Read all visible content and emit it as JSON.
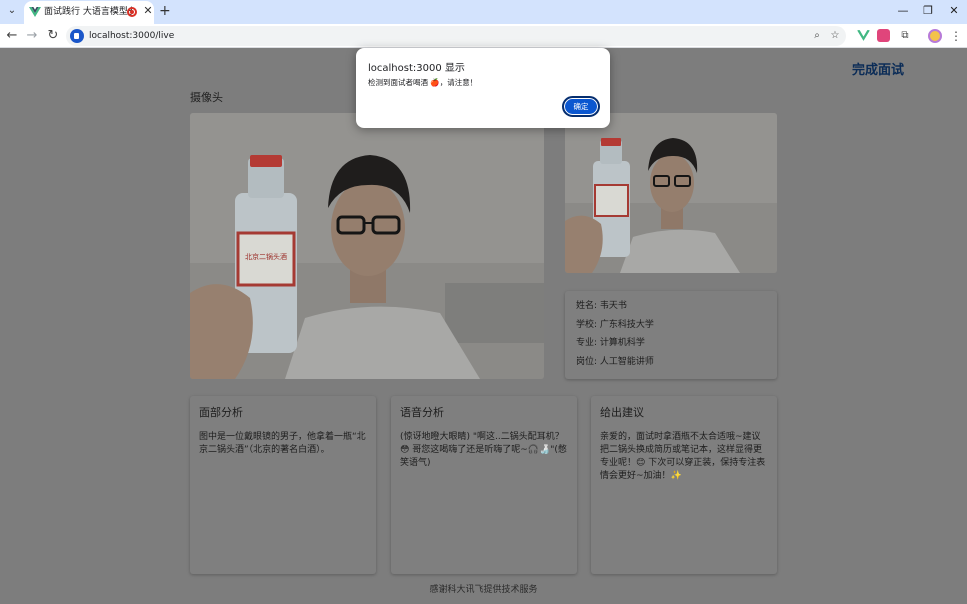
{
  "browser": {
    "tab_title": "面试践行 大语言模型多模态",
    "url": "localhost:3000/live",
    "new_tab": "+",
    "close_tab": "✕"
  },
  "page": {
    "finish_button": "完成面试",
    "camera_label": "摄像头",
    "candidate": {
      "name": "姓名: 韦天书",
      "school": "学校: 广东科技大学",
      "major": "专业: 计算机科学",
      "position": "岗位: 人工智能讲师"
    },
    "panels": [
      {
        "title": "面部分析",
        "body": "图中是一位戴眼镜的男子，他拿着一瓶“北京二锅头酒”（北京的著名白酒）。"
      },
      {
        "title": "语音分析",
        "body": "(惊讶地瞪大眼睛) \"啊这..二锅头配耳机？😳 哥您这喝嗨了还是听嗨了呢~🎧🍶\"(憋笑语气)"
      },
      {
        "title": "给出建议",
        "body": "亲爱的，面试时拿酒瓶不太合适哦~建议把二锅头换成简历或笔记本，这样显得更专业呢！😊 下次可以穿正装，保持专注表情会更好~加油！✨"
      }
    ],
    "footer": "感谢科大讯飞提供技术服务",
    "bottle_label": "北京二锅头酒"
  },
  "dialog": {
    "title": "localhost:3000 显示",
    "message": "检测到面试者喝酒 🍎，请注意！",
    "ok_button": "确定"
  },
  "colors": {
    "tabstrip": "#d3e3fd",
    "dialog_button": "#0b57d0",
    "finish_button": "#0b2c57",
    "overlay_background": "#7d7d7d"
  }
}
